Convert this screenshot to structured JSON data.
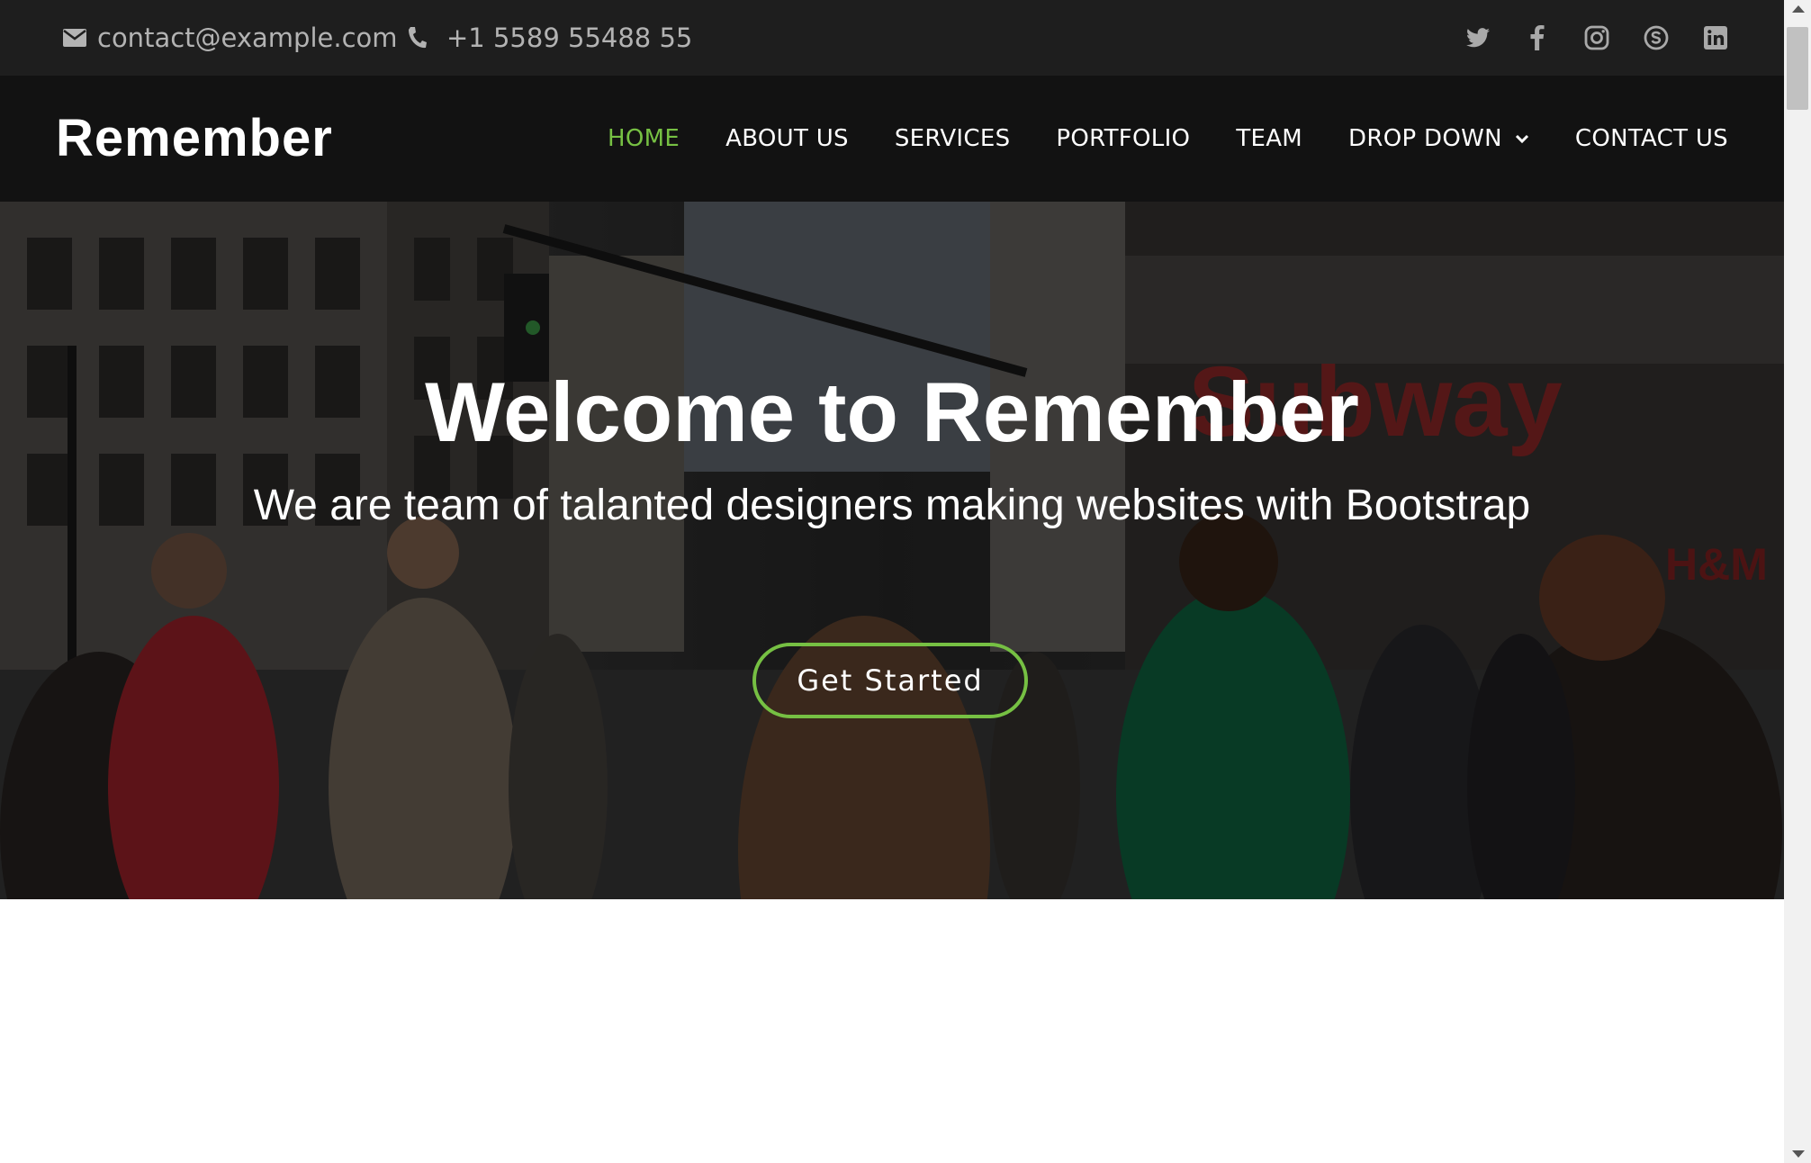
{
  "topbar": {
    "email": "contact@example.com",
    "phone": "+1 5589 55488 55",
    "socials": [
      "twitter-icon",
      "facebook-icon",
      "instagram-icon",
      "skype-icon",
      "linkedin-icon"
    ]
  },
  "header": {
    "logo": "Remember",
    "nav": [
      {
        "label": "HOME",
        "active": true
      },
      {
        "label": "ABOUT US"
      },
      {
        "label": "SERVICES"
      },
      {
        "label": "PORTFOLIO"
      },
      {
        "label": "TEAM"
      },
      {
        "label": "DROP DOWN",
        "dropdown": true
      },
      {
        "label": "CONTACT US"
      }
    ]
  },
  "hero": {
    "title": "Welcome to Remember",
    "subtitle": "We are team of talanted designers making websites with Bootstrap",
    "cta": "Get Started"
  },
  "colors": {
    "accent": "#76c043",
    "topbar_bg": "#1e1e1e",
    "header_bg": "#121212"
  }
}
